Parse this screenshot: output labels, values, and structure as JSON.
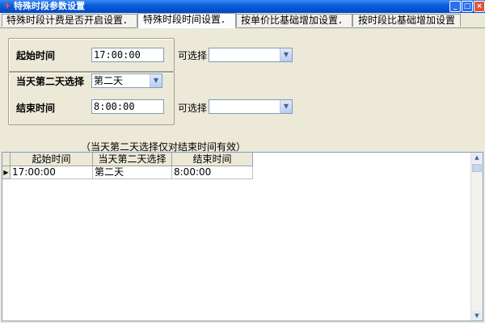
{
  "window": {
    "title": "特殊时段参数设置",
    "icon": "app-icon",
    "controls": {
      "minimize": "_",
      "maximize": "□",
      "close": "×"
    }
  },
  "tabs": [
    {
      "label": "特殊时段计费是否开启设置．",
      "active": false
    },
    {
      "label": "特殊时段时间设置．",
      "active": true
    },
    {
      "label": "按单价比基础增加设置．",
      "active": false
    },
    {
      "label": "按时段比基础增加设置",
      "active": false
    }
  ],
  "form": {
    "start_time": {
      "label": "起始时间",
      "value": "17:00:00"
    },
    "next_day": {
      "label": "当天第二天选择",
      "value": "第二天"
    },
    "end_time": {
      "label": "结束时间",
      "value": "8:00:00"
    },
    "optional_start": {
      "label": "可选择",
      "value": ""
    },
    "optional_end": {
      "label": "可选择",
      "value": ""
    }
  },
  "note": "（当天第二天选择仅对结束时间有效）",
  "grid": {
    "columns": [
      "起始时间",
      "当天第二天选择",
      "结束时间"
    ],
    "rows": [
      [
        "17:00:00",
        "第二天",
        "8:00:00"
      ]
    ],
    "current_row_marker": "▶"
  },
  "colors": {
    "titlebar": "#0a5fd8",
    "background": "#ece9d8",
    "field_border": "#7f9db9"
  }
}
